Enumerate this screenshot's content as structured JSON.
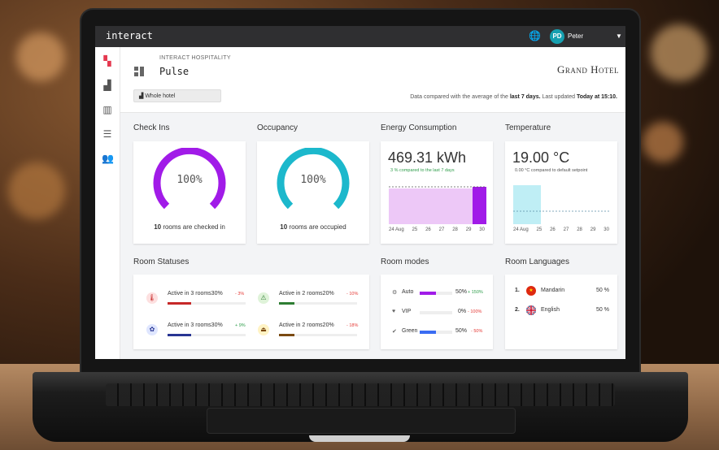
{
  "app": {
    "brand": "interact",
    "user": {
      "initials": "PD",
      "name": "Peter"
    }
  },
  "header": {
    "subtitle": "INTERACT HOSPITALITY",
    "title": "Pulse",
    "logo": "Grand Hotel",
    "selector": "Whole hotel",
    "note_prefix": "Data compared with the average of the ",
    "note_period": "last 7 days.",
    "note_mid": " Last updated ",
    "note_updated": "Today at 15:10."
  },
  "checkins": {
    "section": "Check Ins",
    "percent": "100%",
    "caption_count": "10",
    "caption_text": " rooms are checked in",
    "color": "#a11be8"
  },
  "occupancy": {
    "section": "Occupancy",
    "percent": "100%",
    "caption_count": "10",
    "caption_text": " rooms are occupied",
    "color": "#1cb8cc"
  },
  "energy": {
    "section": "Energy Consumption",
    "value": "469.31 kWh",
    "note": "3 % compared to the last 7 days",
    "xticks": [
      "24 Aug",
      "25",
      "26",
      "27",
      "28",
      "29",
      "30"
    ],
    "color": "#a11be8"
  },
  "temperature": {
    "section": "Temperature",
    "value": "19.00 °C",
    "note": "0.00 °C compared to default setpoint",
    "xticks": [
      "24 Aug",
      "25",
      "26",
      "27",
      "28",
      "29",
      "30"
    ],
    "color": "#9ee3ee"
  },
  "room_statuses": {
    "section": "Room Statuses",
    "items": [
      {
        "label": "Active in 3 rooms30%",
        "delta": "- 3%",
        "delta_color": "#e53935",
        "bar_color": "#c62828",
        "fill": 0.3,
        "icon_bg": "#fde0e0",
        "icon": "🌡"
      },
      {
        "label": "Active in 2 rooms20%",
        "delta": "- 10%",
        "delta_color": "#e53935",
        "bar_color": "#2e7d32",
        "fill": 0.2,
        "icon_bg": "#dff3d9",
        "icon": "⚠"
      },
      {
        "label": "Active in 3 rooms30%",
        "delta": "+ 9%",
        "delta_color": "#2e9d4a",
        "bar_color": "#283593",
        "fill": 0.3,
        "icon_bg": "#dfe6ff",
        "icon": "✿"
      },
      {
        "label": "Active in 2 rooms20%",
        "delta": "- 18%",
        "delta_color": "#e53935",
        "bar_color": "#7b4a12",
        "fill": 0.2,
        "icon_bg": "#fff3c4",
        "icon": "⏏"
      }
    ]
  },
  "room_modes": {
    "section": "Room modes",
    "items": [
      {
        "icon": "⚙",
        "label": "Auto",
        "pct": "50%",
        "delta": "+ 150%",
        "delta_color": "#2e9d4a",
        "fill": 0.5,
        "color": "#a11be8"
      },
      {
        "icon": "♥",
        "label": "VIP",
        "pct": "0%",
        "delta": "- 100%",
        "delta_color": "#e53935",
        "fill": 0.0,
        "color": "#a11be8"
      },
      {
        "icon": "✔",
        "label": "Green",
        "pct": "50%",
        "delta": "- 50%",
        "delta_color": "#e53935",
        "fill": 0.5,
        "color": "#3a6cf2"
      }
    ]
  },
  "room_languages": {
    "section": "Room Languages",
    "items": [
      {
        "rank": "1.",
        "flag": "CN",
        "name": "Mandarin",
        "pct": "50 %"
      },
      {
        "rank": "2.",
        "flag": "UK",
        "name": "English",
        "pct": "50 %"
      }
    ]
  }
}
